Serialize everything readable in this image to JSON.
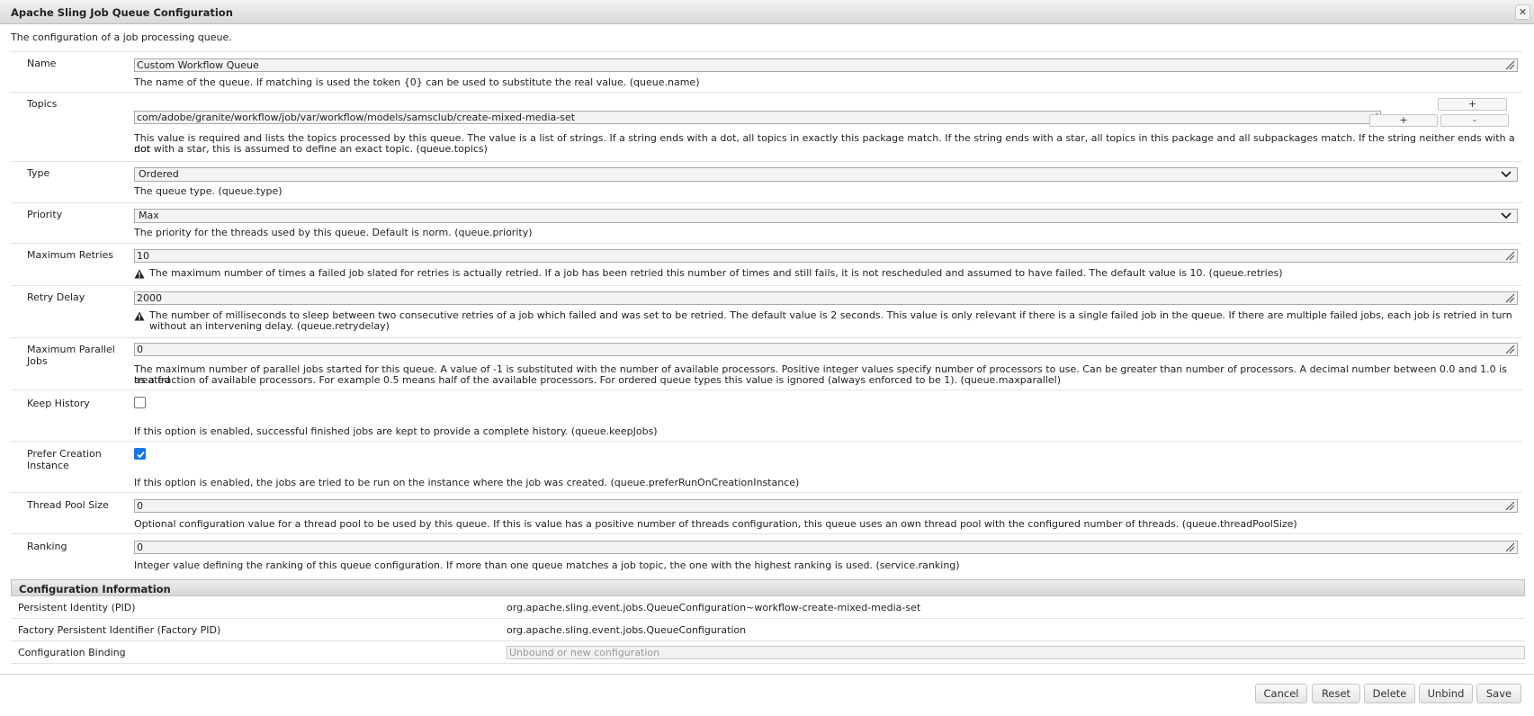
{
  "window": {
    "title": "Apache Sling Job Queue Configuration",
    "description": "The configuration of a job processing queue."
  },
  "fields": {
    "name": {
      "label": "Name",
      "value": "Custom Workflow Queue",
      "help": "The name of the queue. If matching is used the token {0} can be used to substitute the real value. (queue.name)"
    },
    "topics": {
      "label": "Topics",
      "value": "com/adobe/granite/workflow/job/var/workflow/models/samsclub/create-mixed-media-set",
      "help_line1": "This value is required and lists the topics processed by this queue. The value is a list of strings. If a string ends with a dot, all topics in exactly this package match. If the string ends with a star, all topics in this package and all subpackages match. If the string neither ends with a dot",
      "help_line2": "nor with a star, this is assumed to define an exact topic. (queue.topics)",
      "add_label": "+",
      "remove_label": "-"
    },
    "type": {
      "label": "Type",
      "value": "Ordered",
      "help": "The queue type. (queue.type)"
    },
    "priority": {
      "label": "Priority",
      "value": "Max",
      "help": "The priority for the threads used by this queue. Default is norm. (queue.priority)"
    },
    "max_retries": {
      "label": "Maximum Retries",
      "value": "10",
      "help": "The maximum number of times a failed job slated for retries is actually retried. If a job has been retried this number of times and still fails, it is not rescheduled and assumed to have failed. The default value is 10. (queue.retries)"
    },
    "retry_delay": {
      "label": "Retry Delay",
      "value": "2000",
      "help_line1": "The number of milliseconds to sleep between two consecutive retries of a job which failed and was set to be retried. The default value is 2 seconds. This value is only relevant if there is a single failed job in the queue. If there are multiple failed jobs, each job is retried in turn",
      "help_line2": "without an intervening delay. (queue.retrydelay)"
    },
    "max_parallel": {
      "label_line1": "Maximum Parallel",
      "label_line2": "Jobs",
      "value": "0",
      "help_line1": "The maximum number of parallel jobs started for this queue. A value of -1 is substituted with the number of available processors. Positive integer values specify number of processors to use.  Can be greater than number of processors. A decimal number between 0.0 and 1.0 is treated",
      "help_line2": "as a fraction of available processors. For example 0.5 means half of the available processors. For ordered queue types this value is ignored (always enforced to be 1). (queue.maxparallel)"
    },
    "keep_history": {
      "label": "Keep History",
      "checked": false,
      "help": "If this option is enabled, successful finished jobs are kept to provide a complete history. (queue.keepJobs)"
    },
    "prefer_creation": {
      "label_line1": "Prefer Creation",
      "label_line2": "Instance",
      "checked": true,
      "help": "If this option is enabled, the jobs are tried to be run on the instance where the job was created. (queue.preferRunOnCreationInstance)"
    },
    "thread_pool": {
      "label": "Thread Pool Size",
      "value": "0",
      "help": "Optional configuration value for a thread pool to be used by this queue. If this is value has a positive number of threads configuration, this queue uses an own thread pool with the configured number of threads. (queue.threadPoolSize)"
    },
    "ranking": {
      "label": "Ranking",
      "value": "0",
      "help": "Integer value defining the ranking of this queue configuration. If more than one queue matches a job topic, the one with the highest ranking is used. (service.ranking)"
    }
  },
  "config_info": {
    "heading": "Configuration Information",
    "pid_label": "Persistent Identity (PID)",
    "pid_value": "org.apache.sling.event.jobs.QueueConfiguration~workflow-create-mixed-media-set",
    "factory_label": "Factory Persistent Identifier (Factory PID)",
    "factory_value": "org.apache.sling.event.jobs.QueueConfiguration",
    "binding_label": "Configuration Binding",
    "binding_placeholder": "Unbound or new configuration"
  },
  "buttons": {
    "cancel": "Cancel",
    "reset": "Reset",
    "delete": "Delete",
    "unbind": "Unbind",
    "save": "Save"
  },
  "colors": {
    "checkbox_checked": "#1a73e8",
    "title_bar": "#e0e0e0"
  },
  "icons": {
    "close": "close-icon",
    "warning": "warning-icon",
    "chevron": "chevron-down-icon",
    "resize": "resize-grip-icon"
  }
}
